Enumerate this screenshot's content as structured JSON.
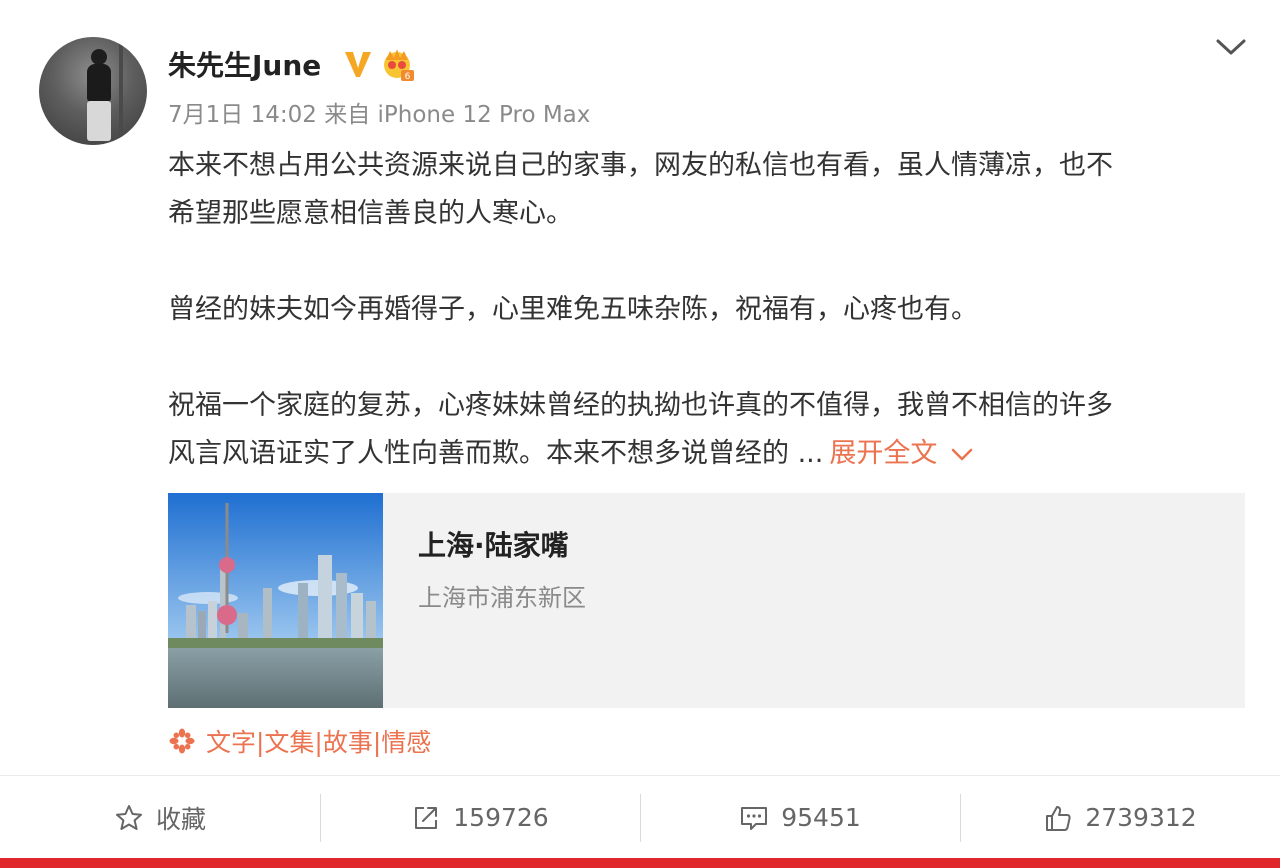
{
  "post": {
    "author": "朱先生June",
    "date": "7月1日 14:02",
    "source_prefix": "来自",
    "source": "iPhone 12 Pro Max",
    "paragraphs": [
      [
        "本来不想占用公共资源来说自己的家事，网友的私信也有看，虽人情薄凉，也不",
        "希望那些愿意相信善良的人寒心。"
      ],
      [
        "曾经的妹夫如今再婚得子，心里难免五味杂陈，祝福有，心疼也有。"
      ],
      [
        "祝福一个家庭的复苏，心疼妹妹曾经的执拗也许真的不值得，我曾不相信的许多",
        "风言风语证实了人性向善而欺。本来不想多说曾经的 ..."
      ]
    ],
    "expand_label": "展开全文",
    "location": {
      "name": "上海·陆家嘴",
      "district": "上海市浦东新区"
    },
    "topic": "文字|文集|故事|情感"
  },
  "actions": {
    "favorite_label": "收藏",
    "repost_count": "159726",
    "comment_count": "95451",
    "like_count": "2739312"
  },
  "colors": {
    "accent": "#eb7350",
    "vip_gold": "#f5a623",
    "bottom_bar": "#e0282c"
  },
  "icons": [
    "vip-v-icon",
    "crown-badge-icon",
    "chevron-down-icon",
    "topic-asterisk-icon",
    "star-icon",
    "share-icon",
    "comment-icon",
    "thumbs-up-icon"
  ]
}
